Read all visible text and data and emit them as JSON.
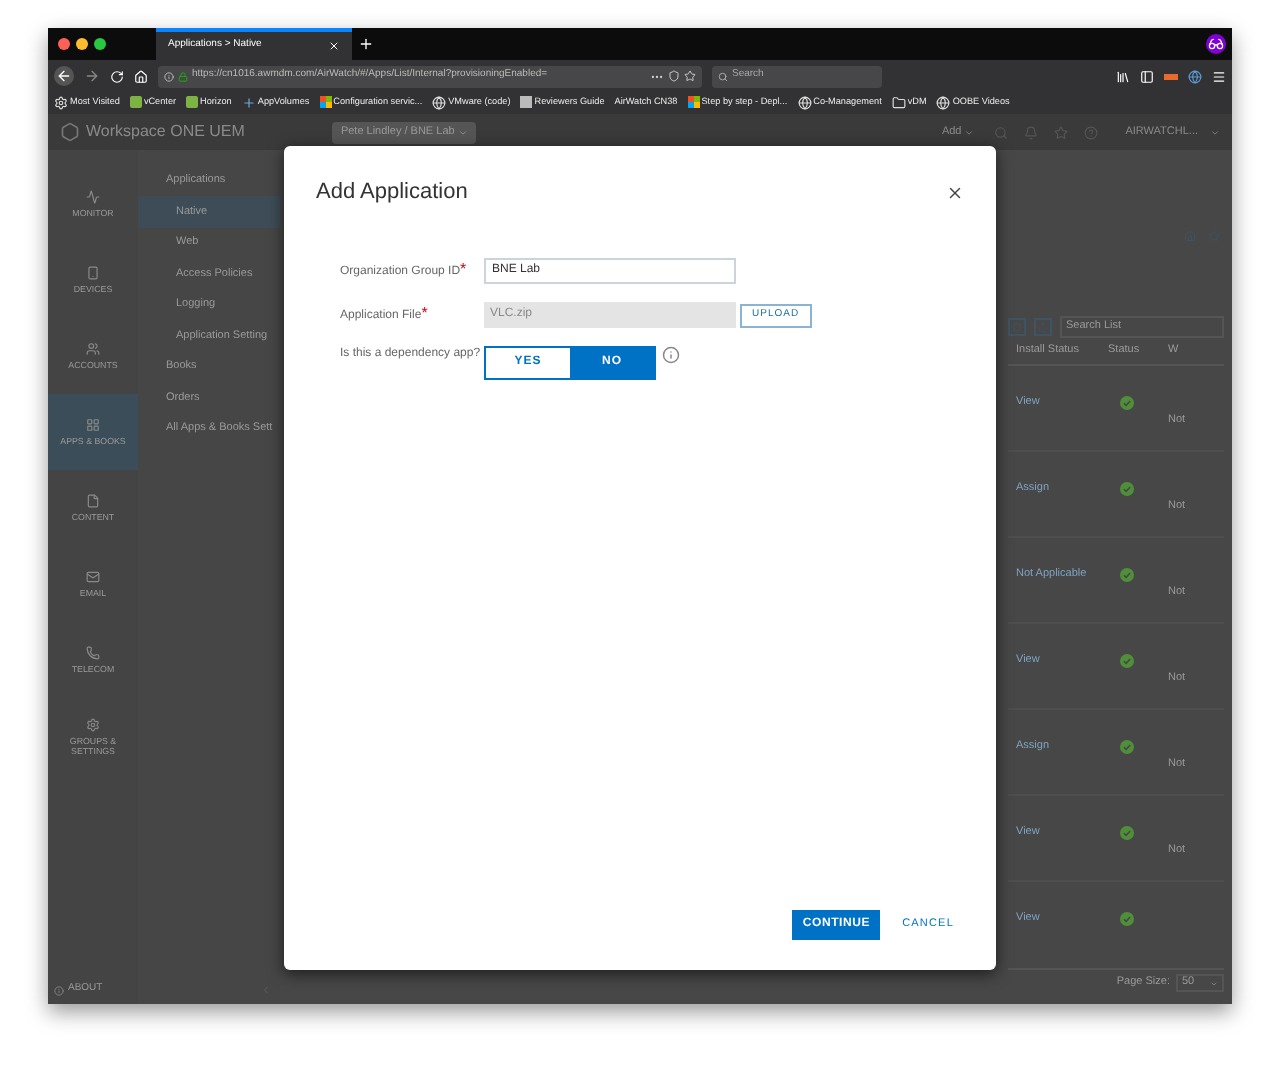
{
  "browser": {
    "tab": {
      "title": "Applications > Native"
    },
    "url": "https://cn1016.awmdm.com/AirWatch/#/Apps/List/Internal?provisioningEnabled=",
    "search": {
      "placeholder": "Search"
    },
    "bookmarks": [
      {
        "label": "Most Visited",
        "kind": "gear"
      },
      {
        "label": "vCenter",
        "kind": "square"
      },
      {
        "label": "Horizon",
        "kind": "square"
      },
      {
        "label": "AppVolumes",
        "kind": "plus"
      },
      {
        "label": "Configuration servic...",
        "kind": "tiles"
      },
      {
        "label": "VMware (code)",
        "kind": "globe"
      },
      {
        "label": "Reviewers Guide",
        "kind": "page"
      },
      {
        "label": "AirWatch CN38",
        "kind": "none"
      },
      {
        "label": "Step by step - Depl...",
        "kind": "tiles"
      },
      {
        "label": "Co-Management",
        "kind": "globe"
      },
      {
        "label": "vDM",
        "kind": "folder"
      },
      {
        "label": "OOBE Videos",
        "kind": "globe"
      }
    ]
  },
  "app": {
    "brand": "Workspace ONE UEM",
    "org": "Pete Lindley / BNE Lab",
    "add": "Add",
    "user": "AIRWATCHL...",
    "sidebar": [
      {
        "label": "MONITOR",
        "selected": false
      },
      {
        "label": "DEVICES",
        "selected": false
      },
      {
        "label": "ACCOUNTS",
        "selected": false
      },
      {
        "label": "APPS & BOOKS",
        "selected": true
      },
      {
        "label": "CONTENT",
        "selected": false
      },
      {
        "label": "EMAIL",
        "selected": false
      },
      {
        "label": "TELECOM",
        "selected": false
      },
      {
        "label": "GROUPS & SETTINGS",
        "selected": false
      }
    ],
    "nav": {
      "heading": "Applications",
      "items": [
        {
          "label": "Native",
          "selected": true
        },
        {
          "label": "Web",
          "selected": false
        },
        {
          "label": "Access Policies",
          "selected": false
        },
        {
          "label": "Logging",
          "selected": false
        },
        {
          "label": "Application Setting",
          "selected": false
        }
      ],
      "sections": [
        "Books",
        "Orders",
        "All Apps & Books Sett"
      ]
    },
    "about": "ABOUT",
    "list": {
      "search": {
        "placeholder": "Search List"
      },
      "columns": [
        "Install Status",
        "Status",
        "W"
      ],
      "rows": [
        {
          "install_status": "View",
          "color": "#4f8f3a",
          "column_3": "Not"
        },
        {
          "install_status": "Assign",
          "color": "#4f8f3a",
          "column_3": "Not"
        },
        {
          "install_status": "Not Applicable",
          "color": "#4f8f3a",
          "column_3": "Not"
        },
        {
          "install_status": "View",
          "color": "#4f8f3a",
          "column_3": "Not"
        },
        {
          "install_status": "Assign",
          "color": "#4f8f3a",
          "column_3": "Not"
        },
        {
          "install_status": "View",
          "color": "#4f8f3a",
          "column_3": "Not"
        },
        {
          "install_status": "View",
          "color": "#4f8f3a"
        }
      ],
      "page_size_label": "Page Size:",
      "page_size": "50"
    }
  },
  "dialog": {
    "title": "Add Application",
    "fields": [
      {
        "label": "Organization Group ID",
        "required_mark": "*",
        "kind": "text",
        "value": "BNE Lab"
      },
      {
        "label": "Application File",
        "required_mark": "*",
        "kind": "file",
        "value": "VLC.zip",
        "button": "UPLOAD"
      },
      {
        "label": "Is this a dependency app?",
        "kind": "toggle",
        "options": [
          {
            "label": "YES",
            "selected": false
          },
          {
            "label": "NO",
            "selected": true
          }
        ]
      }
    ],
    "buttons": [
      {
        "label": "CONTINUE",
        "kind": "primary"
      },
      {
        "label": "CANCEL",
        "kind": "link"
      }
    ]
  }
}
